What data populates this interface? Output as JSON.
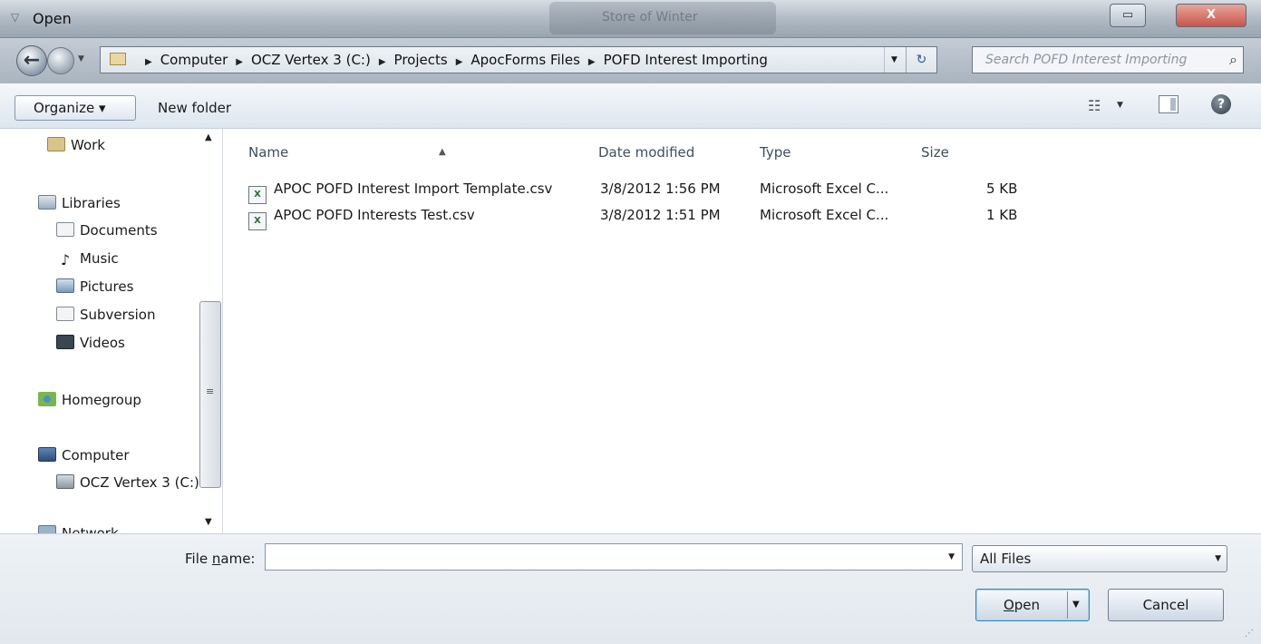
{
  "window": {
    "title": "Open",
    "background_tab": "Store of Winter"
  },
  "address": {
    "breadcrumb": [
      "Computer",
      "OCZ Vertex 3 (C:)",
      "Projects",
      "ApocForms Files",
      "POFD Interest Importing"
    ],
    "search_placeholder": "Search POFD Interest Importing"
  },
  "toolbar": {
    "organize_label": "Organize ▾",
    "new_folder_label": "New folder"
  },
  "nav": {
    "items": [
      {
        "label": "Work",
        "icon": "folder-icon"
      },
      {
        "label": "Libraries",
        "icon": "libraries-icon"
      },
      {
        "label": "Documents",
        "icon": "documents-icon"
      },
      {
        "label": "Music",
        "icon": "music-icon"
      },
      {
        "label": "Pictures",
        "icon": "pictures-icon"
      },
      {
        "label": "Subversion",
        "icon": "subversion-icon"
      },
      {
        "label": "Videos",
        "icon": "videos-icon"
      },
      {
        "label": "Homegroup",
        "icon": "homegroup-icon"
      },
      {
        "label": "Computer",
        "icon": "computer-icon"
      },
      {
        "label": "OCZ Vertex 3 (C:)",
        "icon": "drive-icon"
      },
      {
        "label": "Network",
        "icon": "network-icon"
      }
    ]
  },
  "files": {
    "columns": [
      "Name",
      "Date modified",
      "Type",
      "Size"
    ],
    "rows": [
      {
        "name": "APOC POFD Interest Import Template.csv",
        "date": "3/8/2012 1:56 PM",
        "type": "Microsoft Excel C...",
        "size": "5 KB"
      },
      {
        "name": "APOC POFD Interests Test.csv",
        "date": "3/8/2012 1:51 PM",
        "type": "Microsoft Excel C...",
        "size": "1 KB"
      }
    ]
  },
  "bottom": {
    "file_name_label_pre": "File ",
    "file_name_label_underline": "n",
    "file_name_label_post": "ame:",
    "file_name_value": "",
    "filter_value": "All Files",
    "open_label_underline": "O",
    "open_label_rest": "pen",
    "cancel_label": "Cancel"
  },
  "colors": {
    "titlebar": "#aeb8c3",
    "toolbar": "#dde6ef",
    "accent_button_border": "#3c7fb1"
  }
}
